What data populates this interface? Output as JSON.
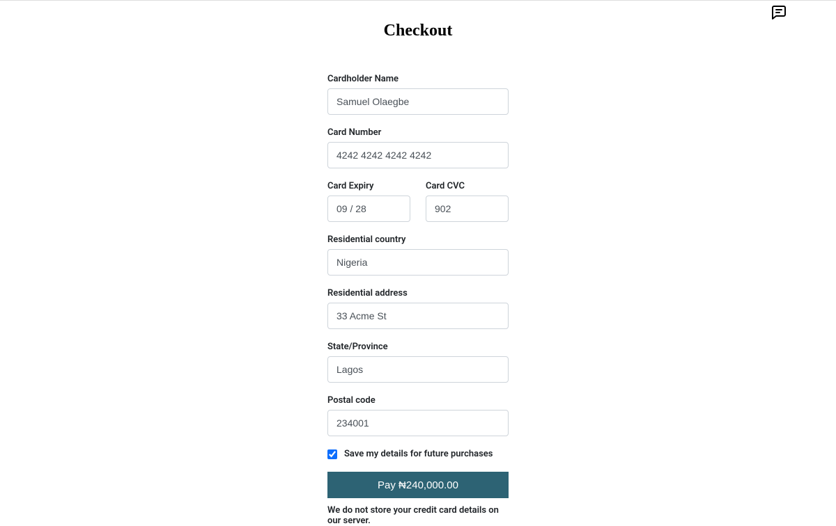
{
  "page": {
    "title": "Checkout"
  },
  "form": {
    "cardholder_name": {
      "label": "Cardholder Name",
      "value": "Samuel Olaegbe"
    },
    "card_number": {
      "label": "Card Number",
      "value": "4242 4242 4242 4242"
    },
    "card_expiry": {
      "label": "Card Expiry",
      "value": "09 / 28"
    },
    "card_cvc": {
      "label": "Card CVC",
      "value": "902"
    },
    "country": {
      "label": "Residential country",
      "value": "Nigeria"
    },
    "address": {
      "label": "Residential address",
      "value": "33 Acme St"
    },
    "state": {
      "label": "State/Province",
      "value": "Lagos"
    },
    "postal": {
      "label": "Postal code",
      "value": "234001"
    },
    "save_details": {
      "label": "Save my details for future purchases",
      "checked": true
    }
  },
  "button": {
    "pay_label": "Pay ₦240,000.00"
  },
  "disclaimer": "We do not store your credit card details on our server."
}
